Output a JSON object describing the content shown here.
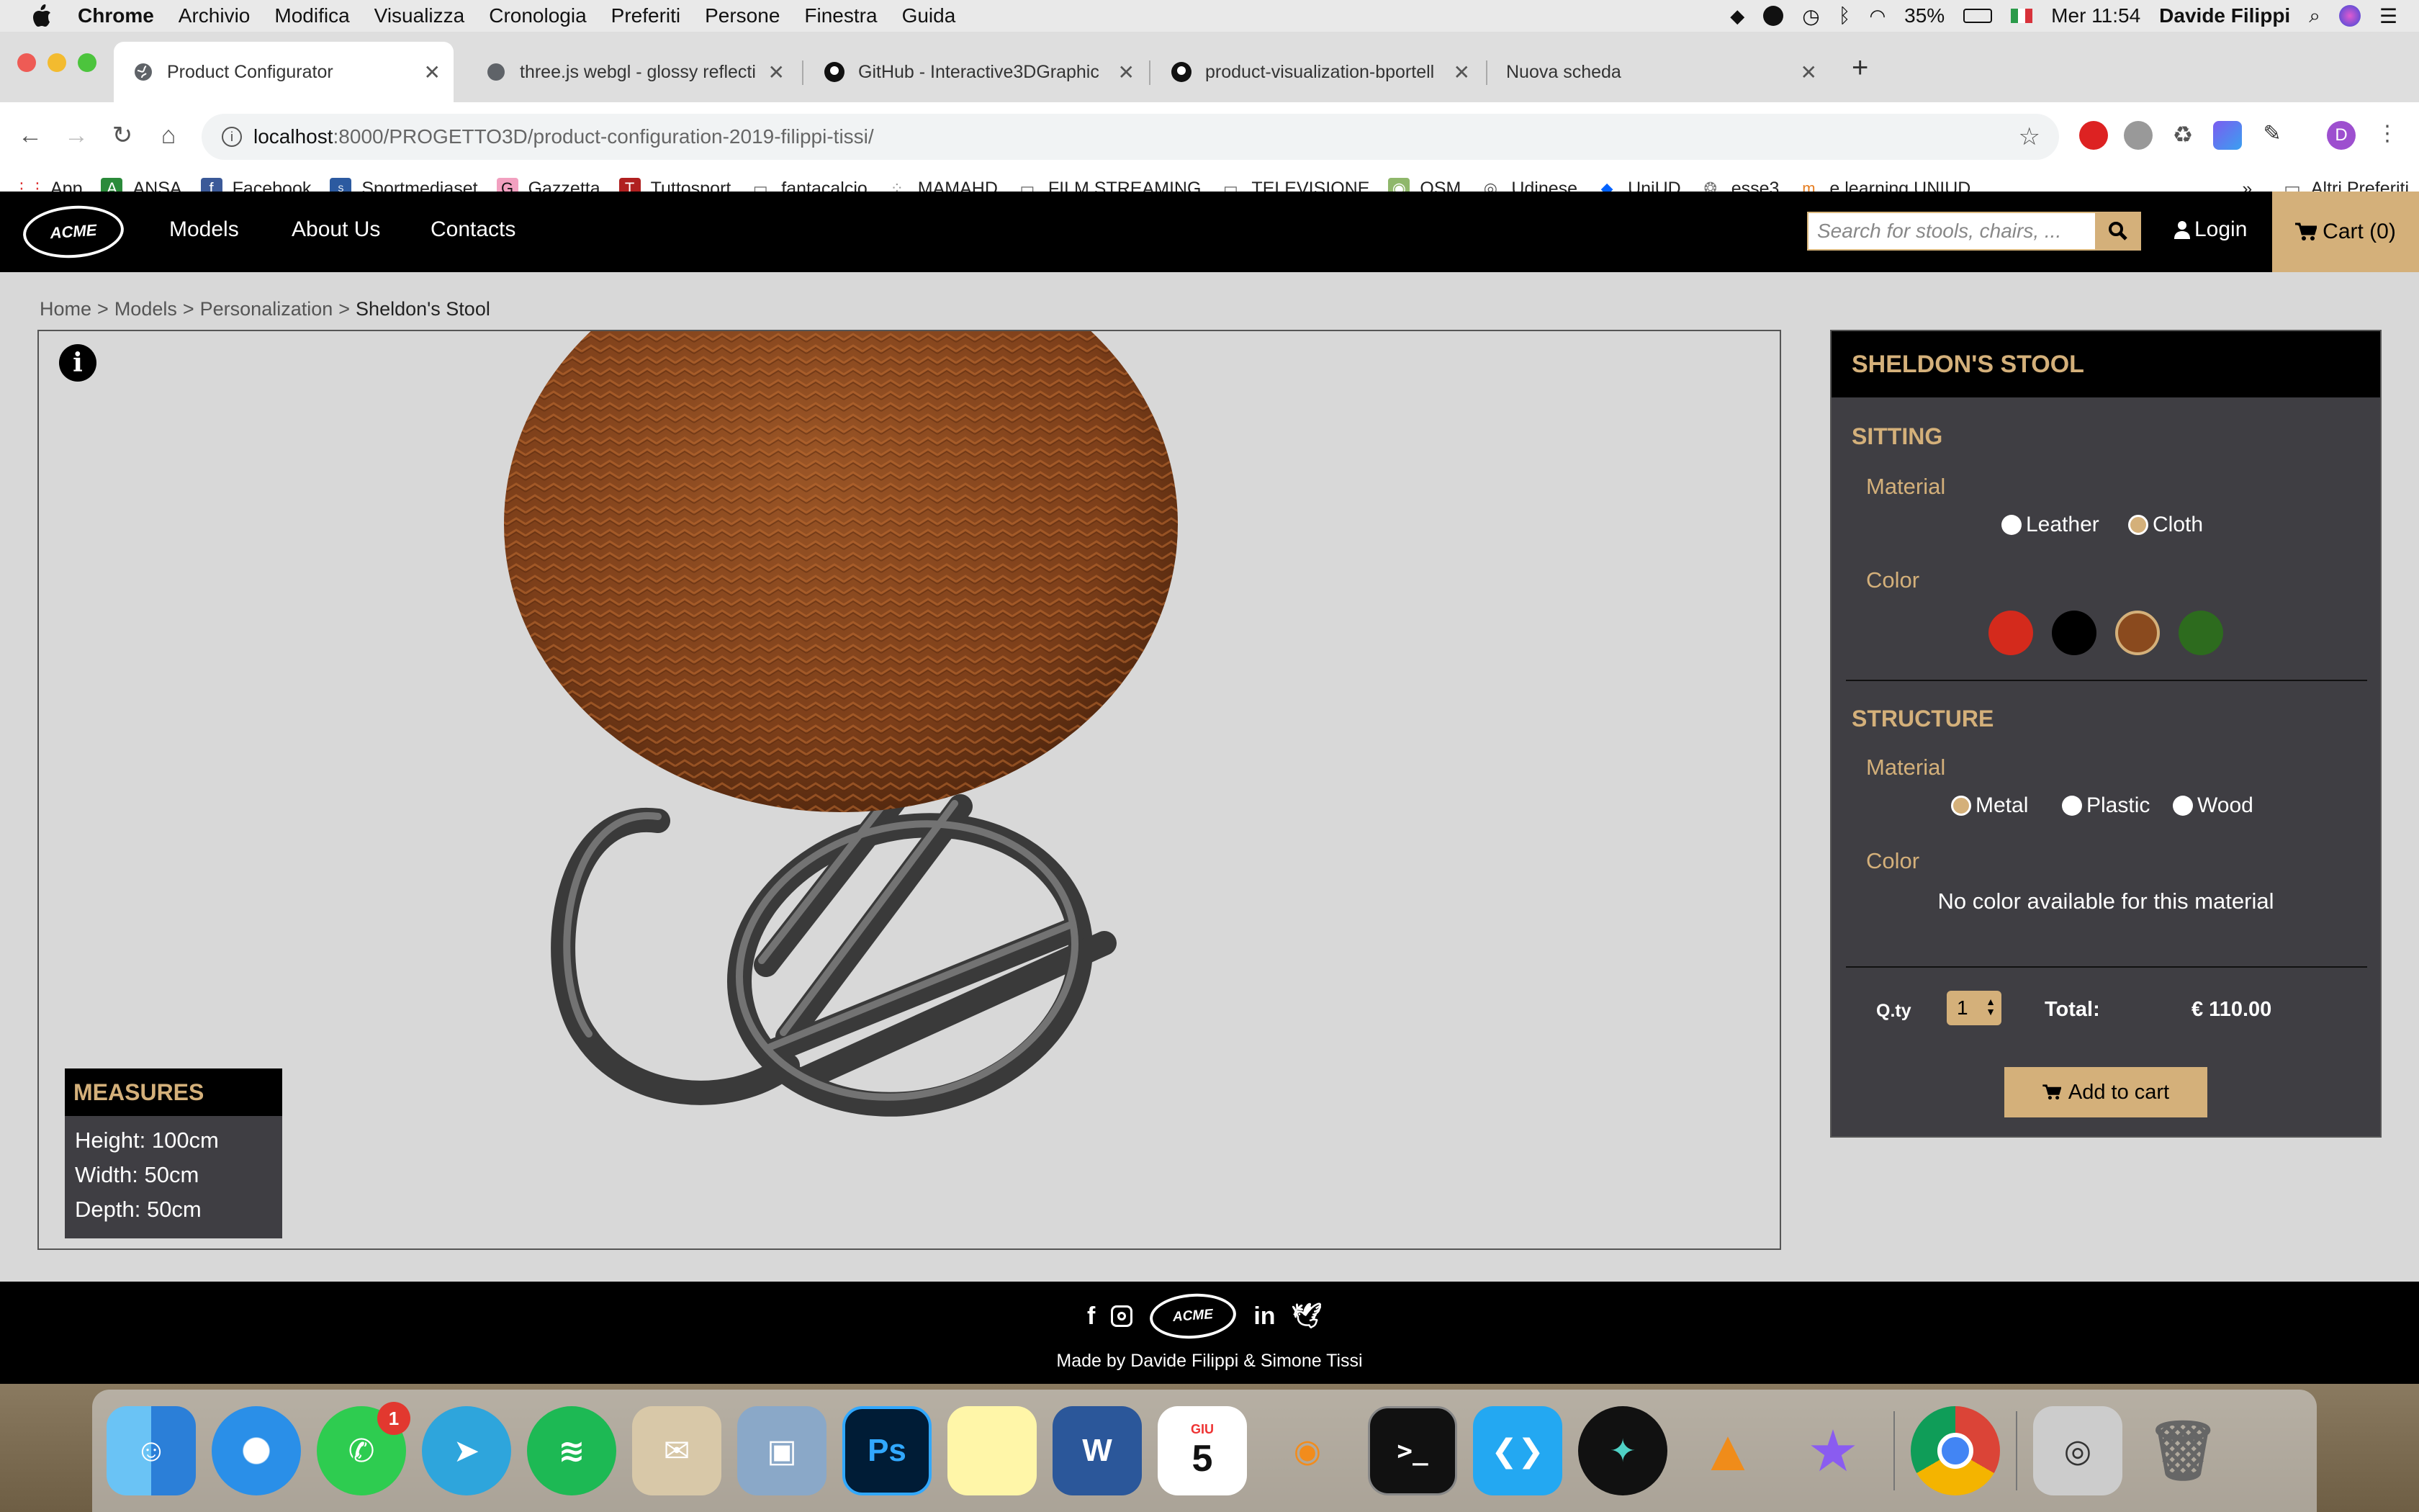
{
  "menubar": {
    "app": "Chrome",
    "items": [
      "Archivio",
      "Modifica",
      "Visualizza",
      "Cronologia",
      "Preferiti",
      "Persone",
      "Finestra",
      "Guida"
    ],
    "battery": "35%",
    "clock": "Mer 11:54",
    "user": "Davide  Filippi"
  },
  "tabs": [
    {
      "title": "Product Configurator"
    },
    {
      "title": "three.js webgl - glossy reflecti"
    },
    {
      "title": "GitHub - Interactive3DGraphic"
    },
    {
      "title": "product-visualization-bportell"
    },
    {
      "title": "Nuova scheda"
    }
  ],
  "address": {
    "host": "localhost",
    "path": ":8000/PROGETTO3D/product-configuration-2019-filippi-tissi/"
  },
  "profile_initial": "D",
  "bookmarks": [
    "App",
    "ANSA",
    "Facebook",
    "Sportmediaset",
    "Gazzetta",
    "Tuttosport",
    "fantacalcio",
    "MAMAHD",
    "FILM STREAMING",
    "TELEVISIONE",
    "OSM",
    "Udinese",
    "UniUD",
    "esse3",
    "e learning UNIUD"
  ],
  "bookmarks_more": "»",
  "bookmarks_other": "Altri Preferiti",
  "site": {
    "logo_text": "ACME",
    "nav": [
      "Models",
      "About Us",
      "Contacts"
    ],
    "search_placeholder": "Search for stools, chairs, ...",
    "login": "Login",
    "cart": "Cart (0)"
  },
  "breadcrumb": [
    "Home",
    "Models",
    "Personalization",
    "Sheldon's Stool"
  ],
  "breadcrumb_sep": ">",
  "measures": {
    "title": "MEASURES",
    "lines": [
      "Height: 100cm",
      "Width: 50cm",
      "Depth: 50cm"
    ]
  },
  "config": {
    "product": "SHELDON'S STOOL",
    "sitting": {
      "title": "SITTING",
      "material_label": "Material",
      "materials": [
        "Leather",
        "Cloth"
      ],
      "selected_material": "Cloth",
      "color_label": "Color",
      "colors": [
        "#d42a1c",
        "#000000",
        "#8a4a1e",
        "#2d6b1e"
      ],
      "selected_color": "#8a4a1e"
    },
    "structure": {
      "title": "STRUCTURE",
      "material_label": "Material",
      "materials": [
        "Metal",
        "Plastic",
        "Wood"
      ],
      "selected_material": "Metal",
      "color_label": "Color",
      "no_color": "No color available for this material"
    },
    "qty_label": "Q.ty",
    "qty": "1",
    "total_label": "Total:",
    "total": "€ 110.00",
    "add_to_cart": "Add to cart"
  },
  "footer": {
    "made_by": "Made by Davide Filippi & Simone Tissi"
  },
  "dock": {
    "whatsapp_badge": "1",
    "calendar_month": "GIU",
    "calendar_day": "5"
  },
  "colors": {
    "accent": "#d4b07a",
    "panel": "#3f3e43",
    "nav": "#000000"
  }
}
